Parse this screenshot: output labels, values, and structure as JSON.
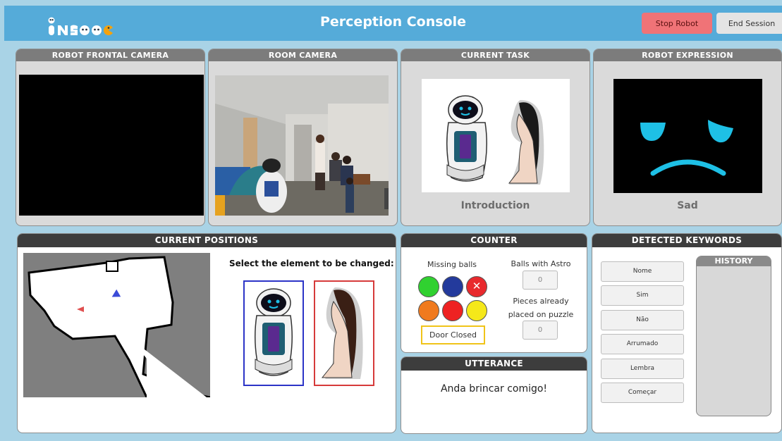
{
  "header": {
    "logo": "INSIDE",
    "title": "Perception Console",
    "stop_label": "Stop Robot",
    "end_label": "End Session"
  },
  "frontal_camera": {
    "title": "ROBOT FRONTAL CAMERA"
  },
  "room_camera": {
    "title": "ROOM CAMERA"
  },
  "current_task": {
    "title": "CURRENT TASK",
    "caption": "Introduction"
  },
  "robot_expression": {
    "title": "ROBOT EXPRESSION",
    "caption": "Sad"
  },
  "current_positions": {
    "title": "CURRENT POSITIONS",
    "prompt": "Select the element to be changed:"
  },
  "counter": {
    "title": "COUNTER",
    "missing_balls_label": "Missing balls",
    "balls": [
      {
        "color": "#30d130",
        "name": "green"
      },
      {
        "color": "#233a9c",
        "name": "blue"
      },
      {
        "color": "#e8292d",
        "name": "red-crossed"
      },
      {
        "color": "#f07a1e",
        "name": "orange"
      },
      {
        "color": "#ee2222",
        "name": "red"
      },
      {
        "color": "#f5e81a",
        "name": "yellow"
      }
    ],
    "door_label": "Door Closed",
    "balls_astro_label": "Balls with Astro",
    "balls_astro_value": "0",
    "pieces_label_1": "Pieces already",
    "pieces_label_2": "placed on puzzle",
    "pieces_value": "0"
  },
  "utterance": {
    "title": "UTTERANCE",
    "text": "Anda brincar comigo!"
  },
  "keywords": {
    "title": "DETECTED KEYWORDS",
    "history_title": "HISTORY",
    "items": [
      "Nome",
      "Sim",
      "Não",
      "Arrumado",
      "Lembra",
      "Começar"
    ]
  },
  "colors": {
    "header": "#55abd9",
    "background": "#a9d3e6",
    "stop_button": "#f07377",
    "robot_box": "#2c34c7",
    "girl_box": "#d63a3a",
    "face_color": "#1ec0e6",
    "door_border": "#f0c419"
  }
}
